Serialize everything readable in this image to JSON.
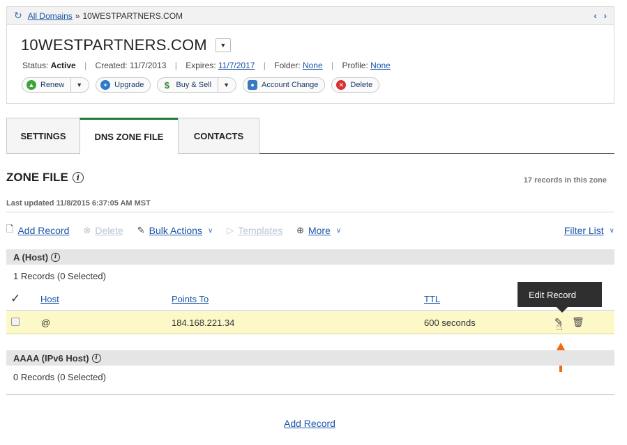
{
  "breadcrumb": {
    "all_domains": "All Domains",
    "separator": "»",
    "current": "10WESTPARTNERS.COM"
  },
  "domain": {
    "name": "10WESTPARTNERS.COM",
    "status_label": "Status:",
    "status_value": "Active",
    "created_label": "Created:",
    "created_value": "11/7/2013",
    "expires_label": "Expires:",
    "expires_value": "11/7/2017",
    "folder_label": "Folder:",
    "folder_value": "None",
    "profile_label": "Profile:",
    "profile_value": "None"
  },
  "actions": {
    "renew": "Renew",
    "upgrade": "Upgrade",
    "buy_sell": "Buy & Sell",
    "account_change": "Account Change",
    "delete": "Delete"
  },
  "tabs": [
    {
      "label": "SETTINGS",
      "active": false
    },
    {
      "label": "DNS ZONE FILE",
      "active": true
    },
    {
      "label": "CONTACTS",
      "active": false
    }
  ],
  "zone": {
    "title": "ZONE FILE",
    "records_count": "17 records in this zone",
    "last_updated": "Last updated 11/8/2015 6:37:05 AM MST"
  },
  "toolbar": {
    "add_record": "Add Record",
    "delete": "Delete",
    "bulk_actions": "Bulk Actions",
    "templates": "Templates",
    "more": "More",
    "filter_list": "Filter List"
  },
  "sections": [
    {
      "title": "A (Host)",
      "summary": "1 Records (0 Selected)",
      "columns": [
        "Host",
        "Points To",
        "TTL"
      ],
      "rows": [
        {
          "host": "@",
          "points_to": "184.168.221.34",
          "ttl": "600 seconds"
        }
      ]
    },
    {
      "title": "AAAA (IPv6 Host)",
      "summary": "0 Records (0 Selected)"
    }
  ],
  "tooltip": "Edit Record",
  "bottom_add": "Add Record",
  "colors": {
    "link": "#1a56a8",
    "active_tab": "#1f7a3a",
    "highlight_row": "#fdf8c7",
    "arrow": "#f26a10"
  }
}
